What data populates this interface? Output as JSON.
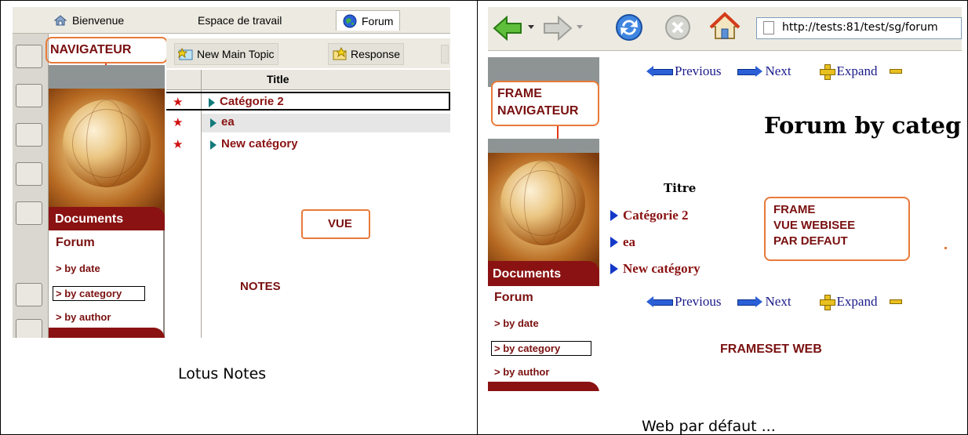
{
  "notes": {
    "tabs": [
      "Bienvenue",
      "Espace de travail",
      "Forum"
    ],
    "navigator_label": "NAVIGATEUR",
    "nav": {
      "documents": "Documents",
      "forum": "Forum",
      "by_date": "> by date",
      "by_category": "> by category",
      "by_author": "> by author"
    },
    "toolbar": {
      "new_main_topic": "New Main Topic",
      "response": "Response"
    },
    "view": {
      "column_title": "Title",
      "rows": [
        "Catégorie 2",
        "ea",
        "New catégory"
      ]
    },
    "vue_label": "VUE",
    "notes_label": "NOTES",
    "caption": "Lotus Notes"
  },
  "web": {
    "address": "http://tests:81/test/sg/forum",
    "frame_nav_label_1": "FRAME",
    "frame_nav_label_2": "NAVIGATEUR",
    "nav": {
      "documents": "Documents",
      "forum": "Forum",
      "by_date": "> by date",
      "by_category": "> by category",
      "by_author": "> by author"
    },
    "pager": {
      "previous": "Previous",
      "next": "Next",
      "expand": "Expand"
    },
    "heading": "Forum by categ",
    "column_title": "Titre",
    "rows": [
      "Catégorie 2",
      "ea",
      "New catégory"
    ],
    "frame_vue_1": "FRAME",
    "frame_vue_2": "VUE WEBISEE",
    "frame_vue_3": "PAR DEFAUT",
    "frameset_label": "FRAMESET WEB",
    "caption": "Web par défaut ..."
  }
}
